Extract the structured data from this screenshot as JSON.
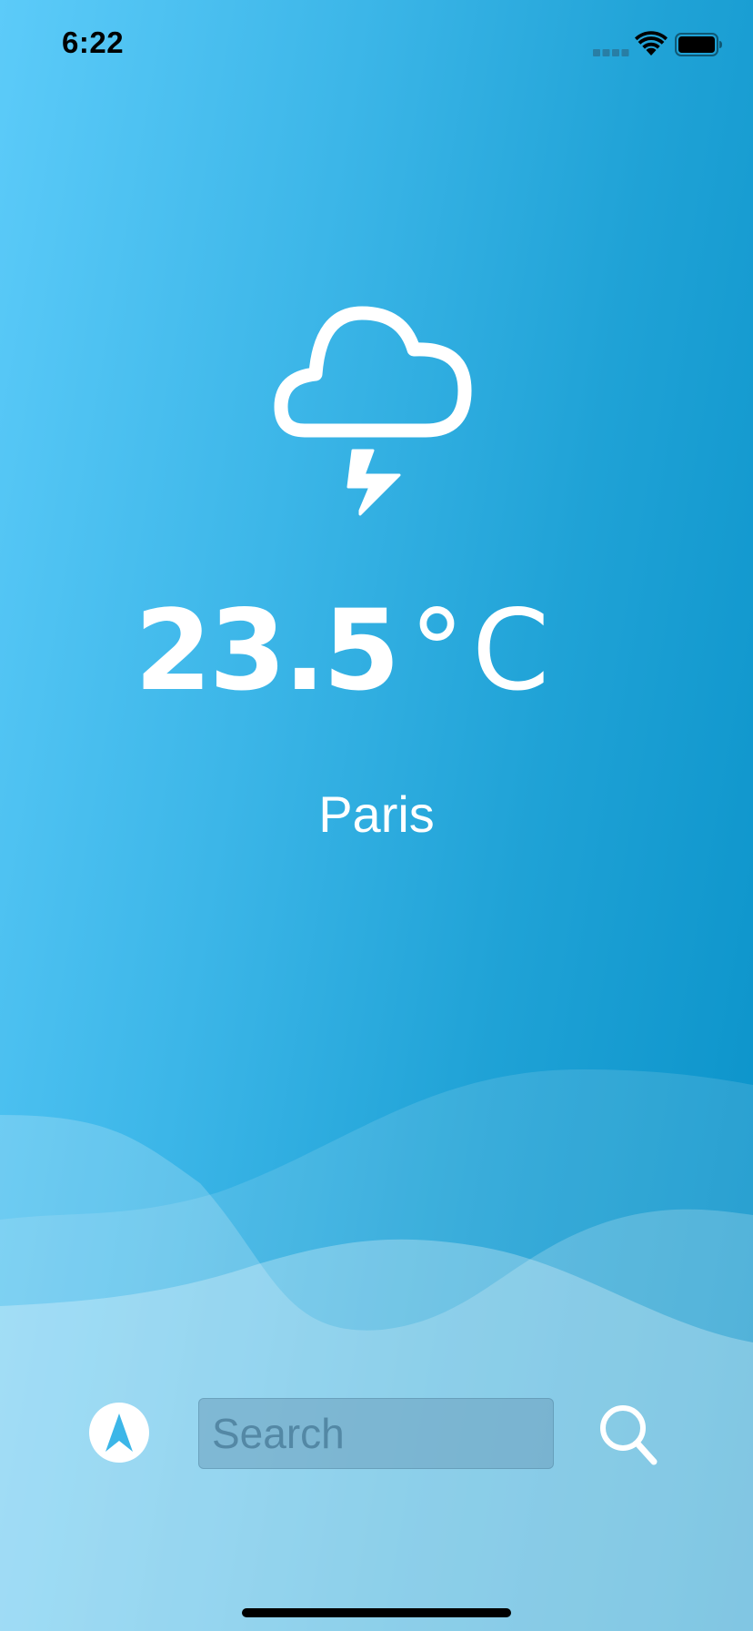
{
  "status_bar": {
    "time": "6:22",
    "signal_icon": "cellular-signal-icon",
    "wifi_icon": "wifi-icon",
    "battery_icon": "battery-icon"
  },
  "weather": {
    "condition_icon": "thunderstorm-icon",
    "temperature": "23.5",
    "unit": "°C",
    "city": "Paris"
  },
  "controls": {
    "location_icon": "location-arrow-icon",
    "search_placeholder": "Search",
    "search_value": "",
    "search_icon": "magnifier-icon"
  },
  "colors": {
    "background_light": "#5ccbf9",
    "background_dark": "#0891c8",
    "foreground": "#ffffff"
  }
}
